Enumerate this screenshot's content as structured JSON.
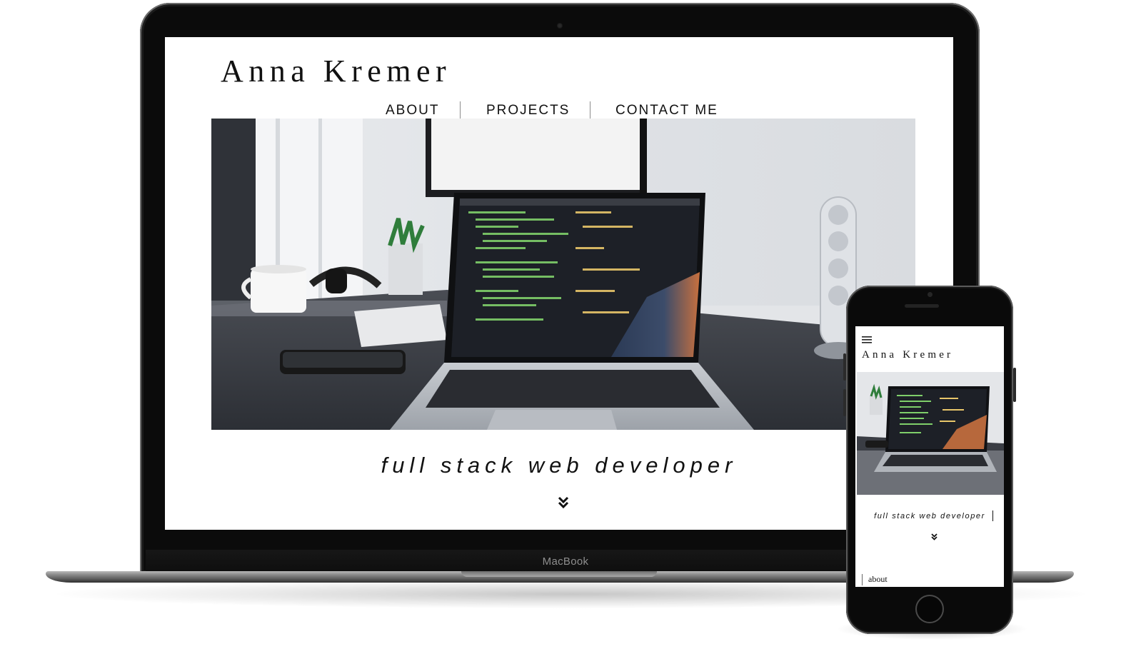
{
  "laptop": {
    "brand_label": "MacBook",
    "site": {
      "title": "Anna Kremer",
      "nav": [
        {
          "label": "ABOUT"
        },
        {
          "label": "PROJECTS"
        },
        {
          "label": "CONTACT ME"
        }
      ],
      "tagline": "full stack web developer",
      "scroll_icon": "double-chevron-down-icon",
      "hero_image": "laptop-on-desk-with-code-photo"
    }
  },
  "phone": {
    "site": {
      "menu_icon": "hamburger-menu-icon",
      "title": "Anna Kremer",
      "tagline": "full stack web developer",
      "scroll_icon": "double-chevron-down-icon",
      "hero_image": "laptop-on-desk-with-code-photo",
      "section_label": "about"
    }
  }
}
